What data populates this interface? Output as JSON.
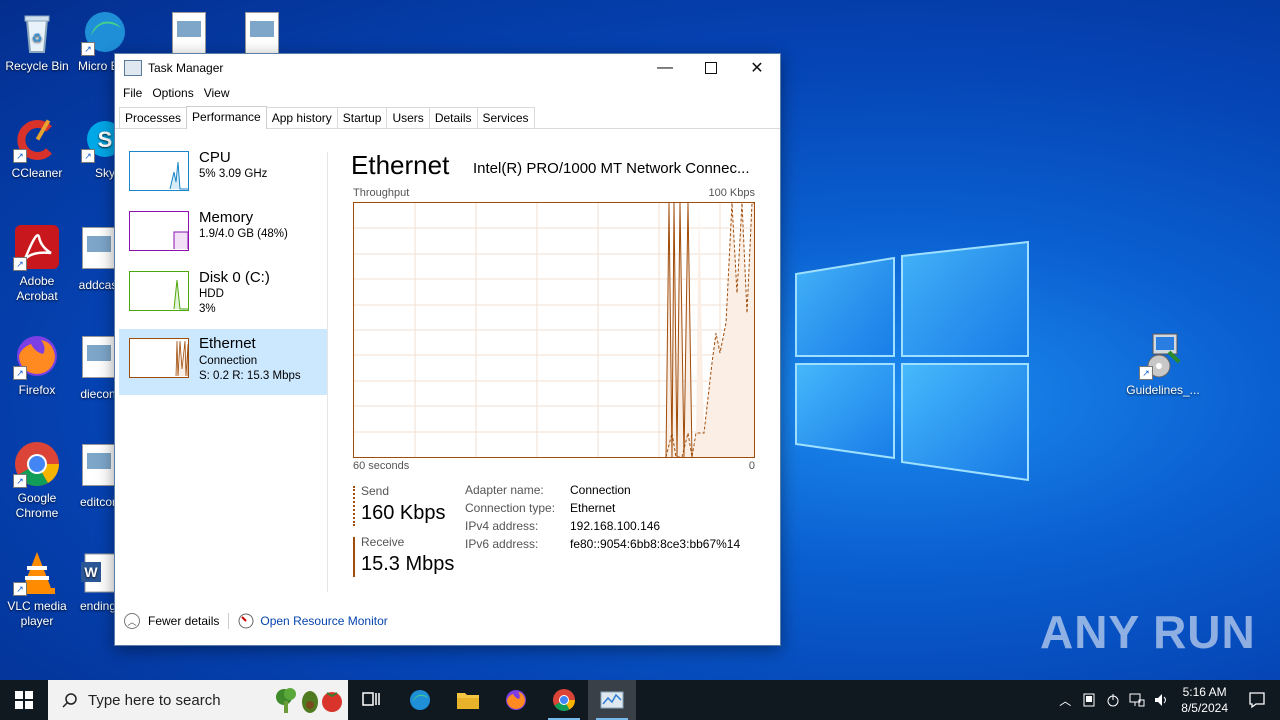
{
  "desktop": {
    "icons": [
      {
        "label": "Recycle Bin"
      },
      {
        "label": "Micro Edg"
      },
      {
        "label": "CCleaner"
      },
      {
        "label": "Sky"
      },
      {
        "label": "Adobe Acrobat"
      },
      {
        "label": "addcas"
      },
      {
        "label": "Firefox"
      },
      {
        "label": "diecon"
      },
      {
        "label": "Google Chrome"
      },
      {
        "label": "editcor"
      },
      {
        "label": "VLC media player"
      },
      {
        "label": "ending"
      },
      {
        "label": "Guidelines_..."
      }
    ],
    "watermark": "ANY RUN"
  },
  "window": {
    "title": "Task Manager",
    "menu": [
      "File",
      "Options",
      "View"
    ],
    "tabs": [
      "Processes",
      "Performance",
      "App history",
      "Startup",
      "Users",
      "Details",
      "Services"
    ],
    "active_tab": "Performance",
    "sidebar": [
      {
        "name": "CPU",
        "sub1": "5% 3.09 GHz",
        "sub2": ""
      },
      {
        "name": "Memory",
        "sub1": "1.9/4.0 GB (48%)",
        "sub2": ""
      },
      {
        "name": "Disk 0 (C:)",
        "sub1": "HDD",
        "sub2": "3%"
      },
      {
        "name": "Ethernet",
        "sub1": "Connection",
        "sub2": "S: 0.2 R: 15.3 Mbps"
      }
    ],
    "main": {
      "title": "Ethernet",
      "adapter": "Intel(R) PRO/1000 MT Network Connec...",
      "throughput_label": "Throughput",
      "max_label": "100 Kbps",
      "time_label": "60 seconds",
      "zero_label": "0",
      "send_label": "Send",
      "send_value": "160 Kbps",
      "receive_label": "Receive",
      "receive_value": "15.3 Mbps",
      "properties": [
        {
          "k": "Adapter name:",
          "v": "Connection"
        },
        {
          "k": "Connection type:",
          "v": "Ethernet"
        },
        {
          "k": "IPv4 address:",
          "v": "192.168.100.146"
        },
        {
          "k": "IPv6 address:",
          "v": "fe80::9054:6bb8:8ce3:bb67%14"
        }
      ]
    },
    "footer": {
      "fewer": "Fewer details",
      "monitor": "Open Resource Monitor"
    }
  },
  "taskbar": {
    "search_placeholder": "Type here to search",
    "time": "5:16 AM",
    "date": "8/5/2024"
  },
  "colors": {
    "accent": "#a04c0a",
    "selection": "#cce8ff",
    "link": "#0645ad"
  }
}
